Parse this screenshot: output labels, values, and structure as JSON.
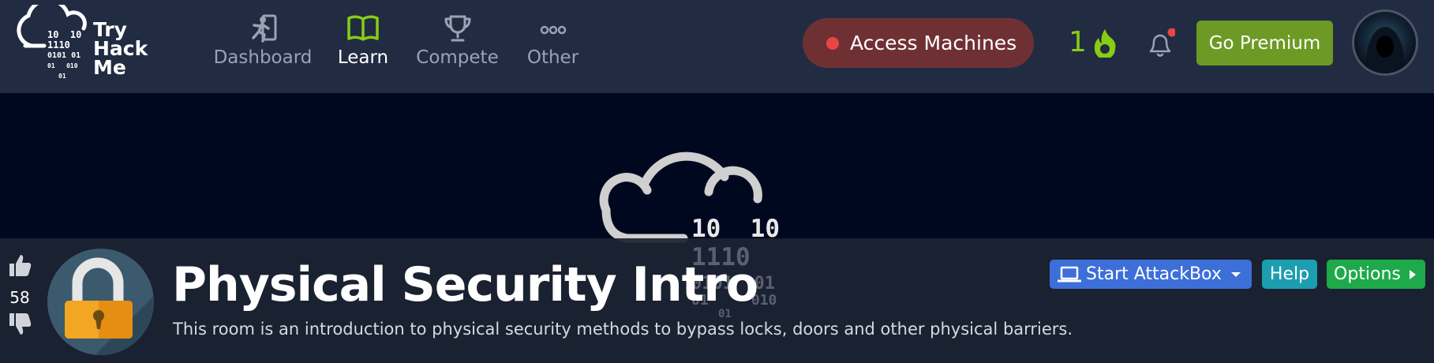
{
  "logo": {
    "line1": "Try",
    "line2": "Hack",
    "line3": "Me"
  },
  "nav": {
    "items": [
      {
        "label": "Dashboard",
        "icon": "running-person-icon"
      },
      {
        "label": "Learn",
        "icon": "open-book-icon",
        "active": true
      },
      {
        "label": "Compete",
        "icon": "trophy-icon"
      },
      {
        "label": "Other",
        "icon": "more-dots-icon"
      }
    ]
  },
  "header": {
    "access_label": "Access Machines",
    "streak_count": "1",
    "premium_label": "Go Premium"
  },
  "room": {
    "title": "Physical Security Intro",
    "description": "This room is an introduction to physical security methods to bypass locks, doors and other physical barriers.",
    "votes": "58"
  },
  "actions": {
    "attackbox_label": "Start AttackBox",
    "help_label": "Help",
    "options_label": "Options"
  },
  "colors": {
    "nav_bg": "#212c42",
    "hero_bg": "#000820",
    "accent_green": "#88cc14",
    "access_bg": "#6f3034",
    "attackbox_blue": "#3d6fd8",
    "help_teal": "#1d9db0",
    "options_green": "#1eaa4a",
    "premium_green": "#6c9a24"
  }
}
